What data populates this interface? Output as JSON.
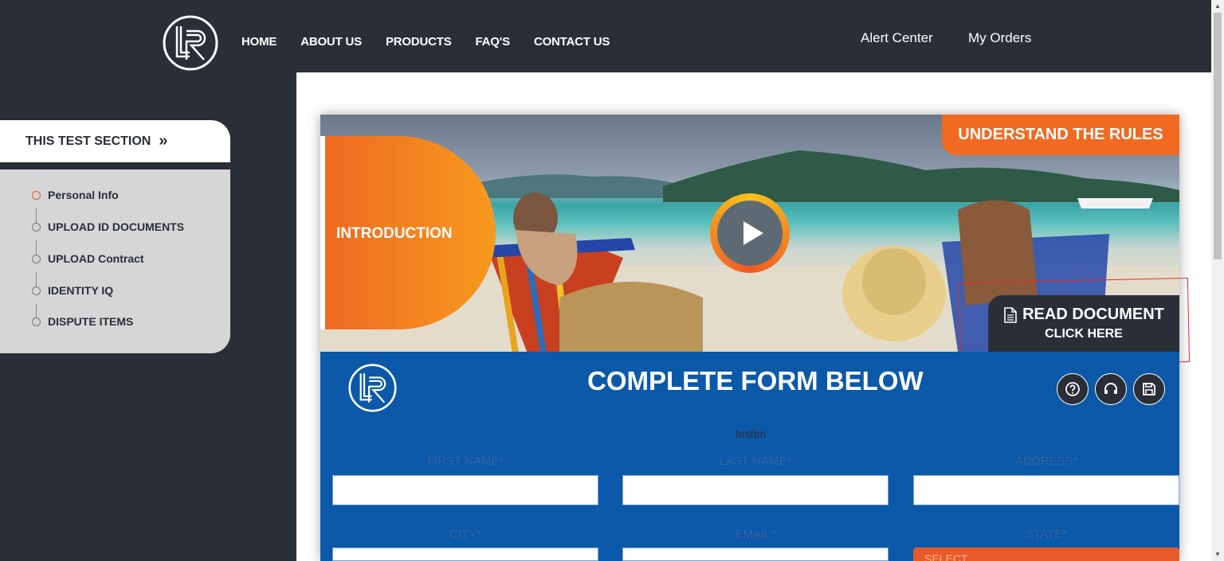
{
  "nav": {
    "items": [
      "HOME",
      "ABOUT US",
      "PRODUCTS",
      "FAQ'S",
      "CONTACT US"
    ],
    "alert_center": "Alert Center",
    "my_orders": "My Orders"
  },
  "sidebar": {
    "section_title": "THIS TEST SECTION",
    "chevron": "»",
    "steps": [
      {
        "label": "Personal Info",
        "active": true
      },
      {
        "label": "UPLOAD ID DOCUMENTS",
        "active": false
      },
      {
        "label": "UPLOAD Contract",
        "active": false
      },
      {
        "label": "IDENTITY IQ",
        "active": false
      },
      {
        "label": "DISPUTE ITEMS",
        "active": false
      }
    ]
  },
  "hero": {
    "intro_label": "INTRODUCTION",
    "rules_label": "UNDERSTAND THE RULES",
    "read_doc_title": "READ DOCUMENT",
    "read_doc_sub": "CLICK HERE"
  },
  "form": {
    "title": "COMPLETE FORM BELOW",
    "name": "testbn",
    "fields": {
      "first_name": "FIRST NAME*",
      "last_name": "LAST NAME*",
      "address": "ADDRESS*",
      "city": "CITY*",
      "email": "EMAIL*",
      "state": "STATE*"
    },
    "state_select": "SELECT"
  },
  "colors": {
    "dark": "#2a2e37",
    "orange": "#f06a22",
    "blue": "#0b59a8",
    "sidebar_gray": "#d6d6d6"
  },
  "icons": [
    "logo-lr",
    "play-icon",
    "document-icon",
    "help-icon",
    "headset-icon",
    "save-icon"
  ]
}
